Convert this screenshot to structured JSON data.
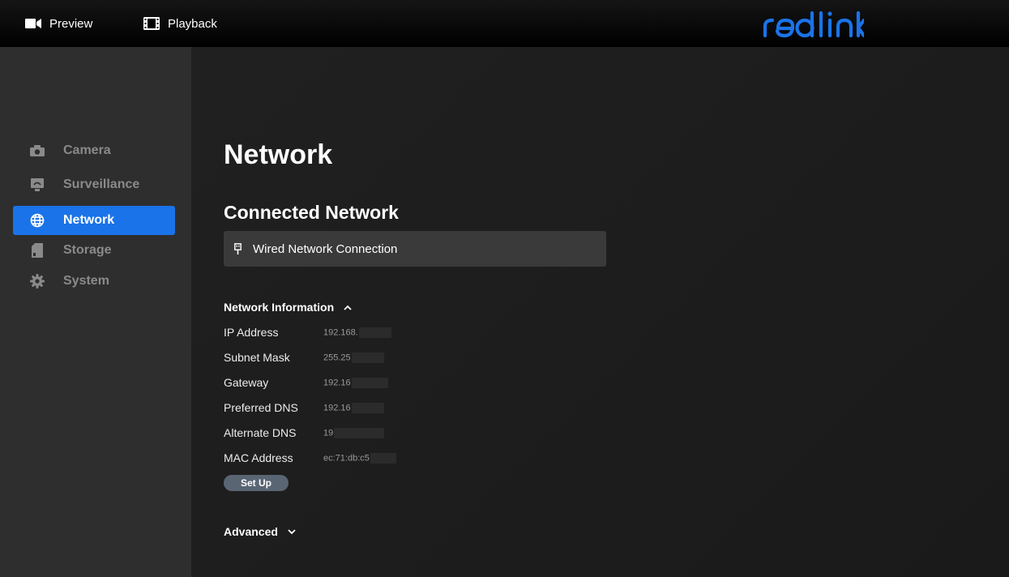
{
  "topbar": {
    "preview_label": "Preview",
    "playback_label": "Playback",
    "logo_text": "reolink",
    "logo_color": "#1a73e8"
  },
  "sidebar": {
    "items": [
      {
        "label": "Camera",
        "icon": "camera-icon",
        "active": false
      },
      {
        "label": "Surveillance",
        "icon": "surveillance-icon",
        "active": false
      },
      {
        "label": "Network",
        "icon": "globe-icon",
        "active": true
      },
      {
        "label": "Storage",
        "icon": "sd-card-icon",
        "active": false
      },
      {
        "label": "System",
        "icon": "gear-icon",
        "active": false
      }
    ],
    "active_color": "#1a73e8"
  },
  "main": {
    "title": "Network",
    "connected_title": "Connected Network",
    "connection_label": "Wired Network Connection",
    "info_header": "Network Information",
    "info_rows": [
      {
        "label": "IP Address",
        "value": "192.168."
      },
      {
        "label": "Subnet Mask",
        "value": "255.25"
      },
      {
        "label": "Gateway",
        "value": "192.16"
      },
      {
        "label": "Preferred DNS",
        "value": "192.16"
      },
      {
        "label": "Alternate DNS",
        "value": "19"
      },
      {
        "label": "MAC Address",
        "value": "ec:71:db:c5"
      }
    ],
    "setup_label": "Set Up",
    "advanced_label": "Advanced"
  }
}
